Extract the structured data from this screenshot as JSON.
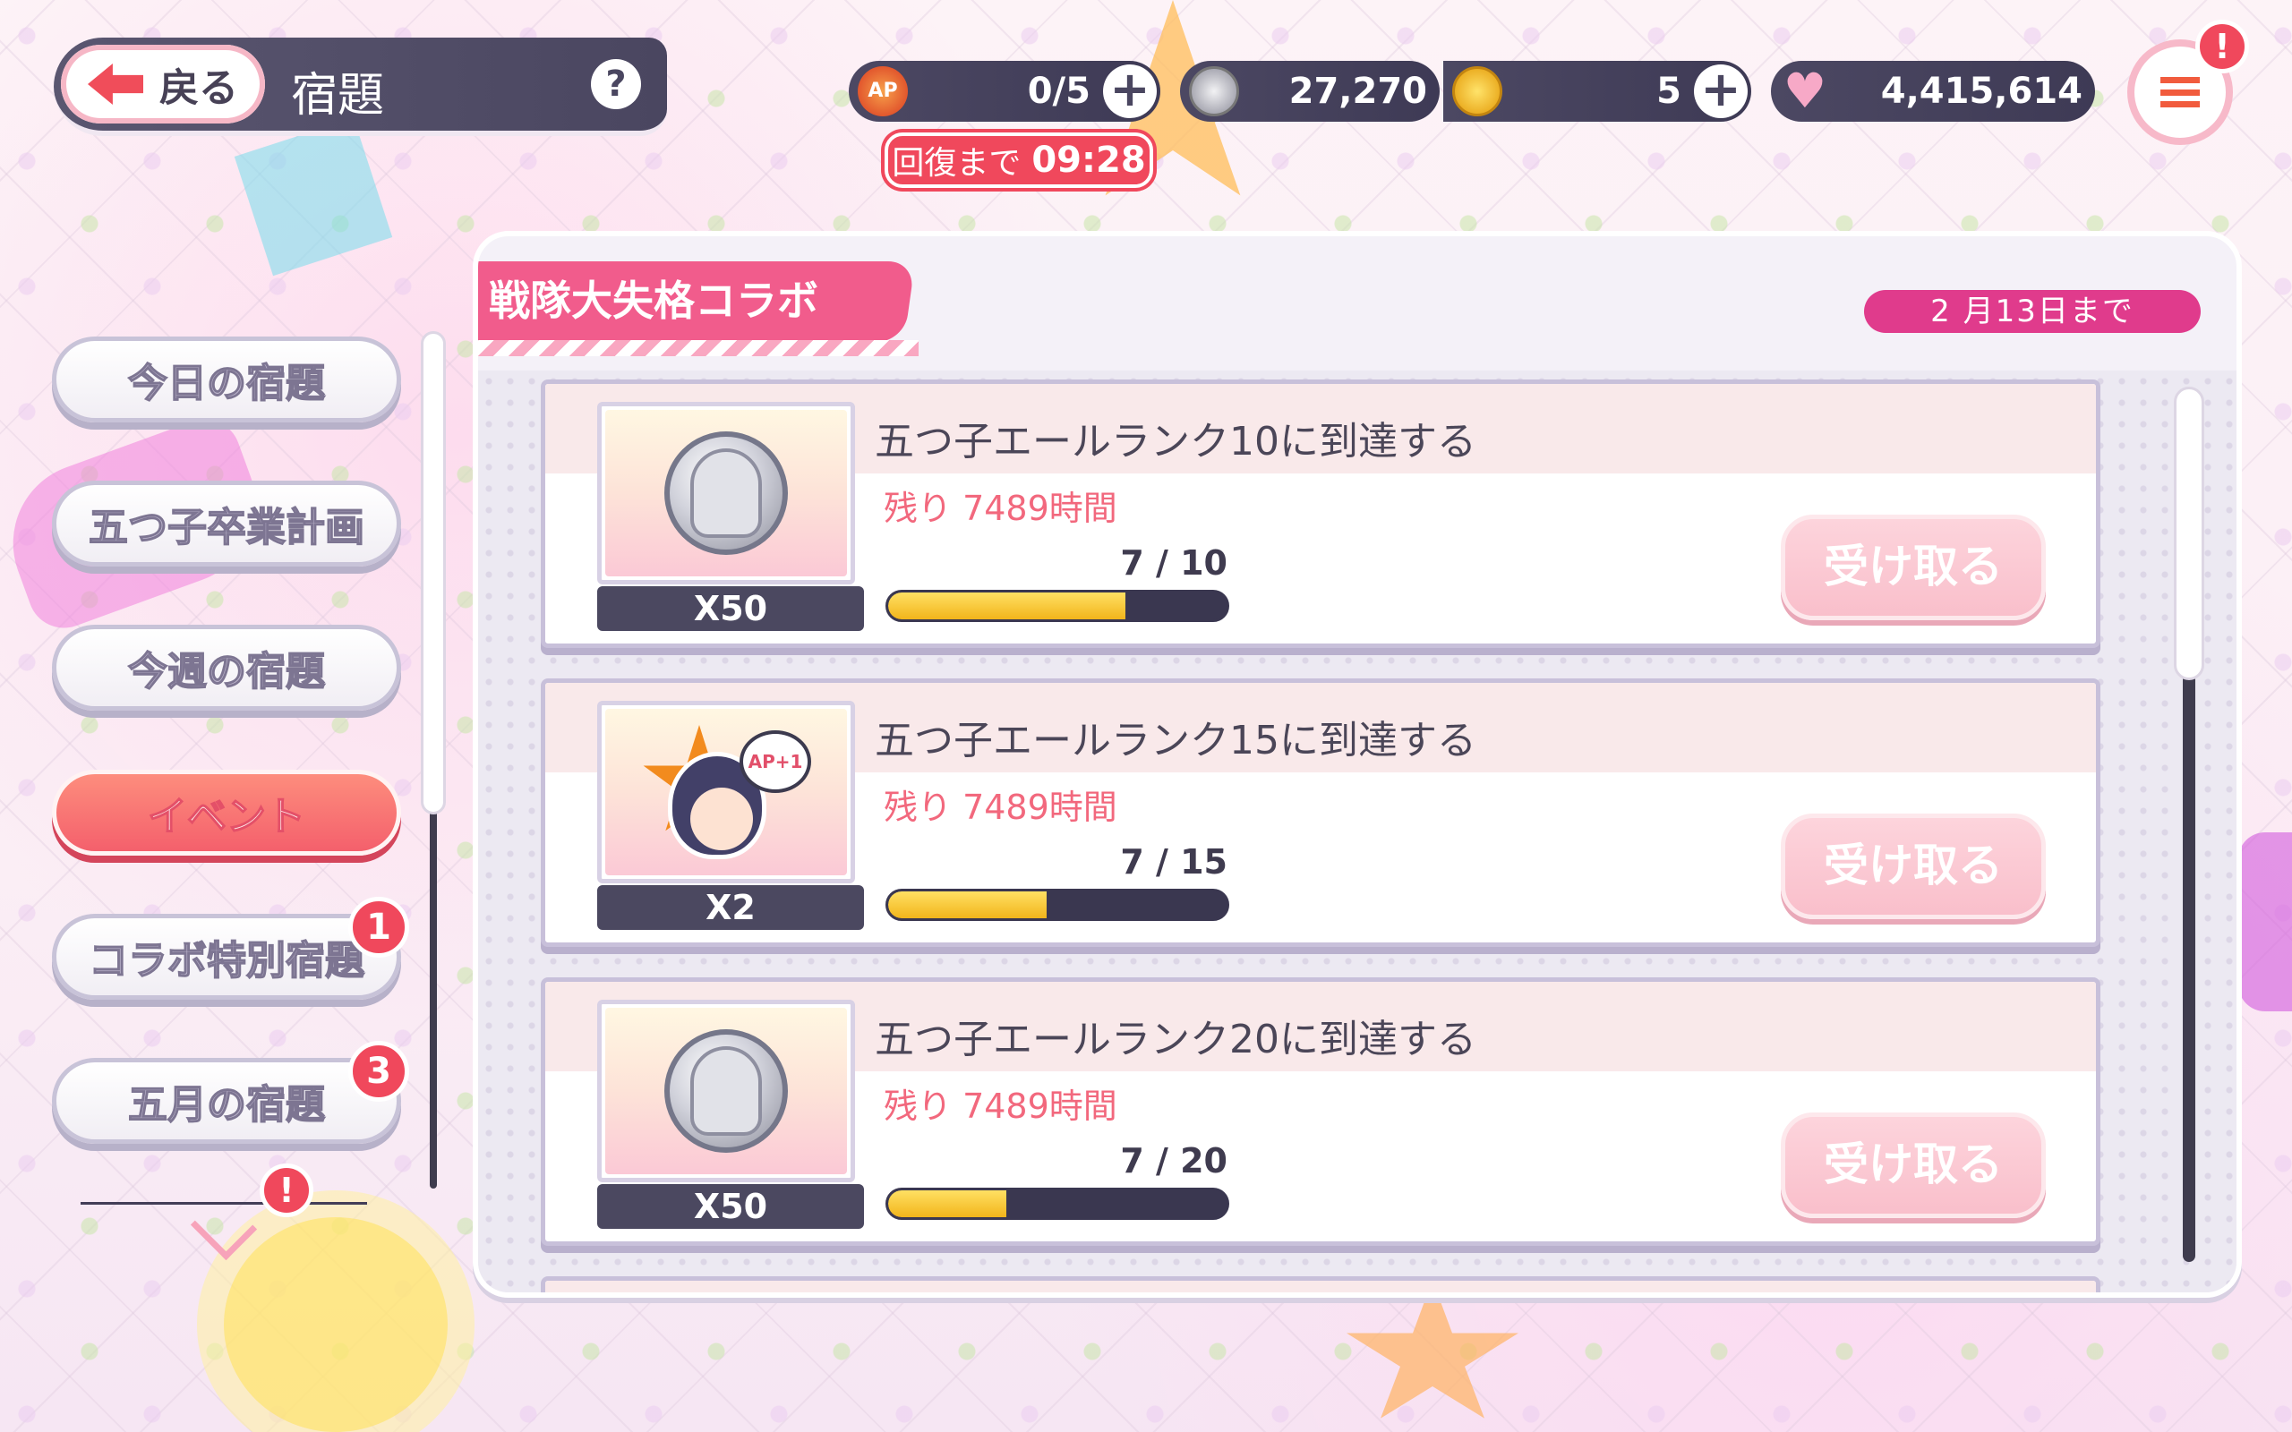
{
  "header": {
    "back_label": "戻る",
    "page_title": "宿題",
    "help_label": "?"
  },
  "resources": {
    "ap": {
      "icon": "ap-icon",
      "icon_label": "AP",
      "value": "0/5",
      "plus": "+"
    },
    "silver": {
      "icon": "silver-coin-icon",
      "value": "27,270"
    },
    "gold": {
      "icon": "gold-coin-icon",
      "value": "5",
      "plus": "+"
    },
    "heart": {
      "icon": "heart-icon",
      "value": "4,415,614"
    }
  },
  "recovery": {
    "label": "回復まで",
    "time": "09:28"
  },
  "menu": {
    "alert": "!"
  },
  "sidebar": {
    "items": [
      {
        "label": "今日の宿題",
        "active": false
      },
      {
        "label": "五つ子卒業計画",
        "active": false
      },
      {
        "label": "今週の宿題",
        "active": false
      },
      {
        "label": "イベント",
        "active": true
      },
      {
        "label": "コラボ特別宿題",
        "active": false,
        "badge": "1"
      },
      {
        "label": "五月の宿題",
        "active": false,
        "badge": "3"
      }
    ],
    "more_alert": "!"
  },
  "event": {
    "title": "戦隊大失格コラボ",
    "deadline": "2 月13日まで"
  },
  "tasks": [
    {
      "title": "五つ子エールランク10に到達する",
      "remaining": "残り 7489時間",
      "progress_text": "7 / 10",
      "progress": 0.7,
      "reward_icon": "silver-coin-icon",
      "reward_qty": "X50",
      "claim_label": "受け取る"
    },
    {
      "title": "五つ子エールランク15に到達する",
      "remaining": "残り 7489時間",
      "progress_text": "7 / 15",
      "progress": 0.467,
      "reward_icon": "ap-recovery-sticker-icon",
      "reward_badge": "AP+1",
      "reward_qty": "X2",
      "claim_label": "受け取る"
    },
    {
      "title": "五つ子エールランク20に到達する",
      "remaining": "残り 7489時間",
      "progress_text": "7 / 20",
      "progress": 0.35,
      "reward_icon": "silver-coin-icon",
      "reward_qty": "X50",
      "claim_label": "受け取る"
    }
  ],
  "colors": {
    "accent_pink": "#f0485c",
    "event_pink": "#f15c8c",
    "progress_fill": "#f2b51b",
    "dark_panel": "#4a4660"
  }
}
